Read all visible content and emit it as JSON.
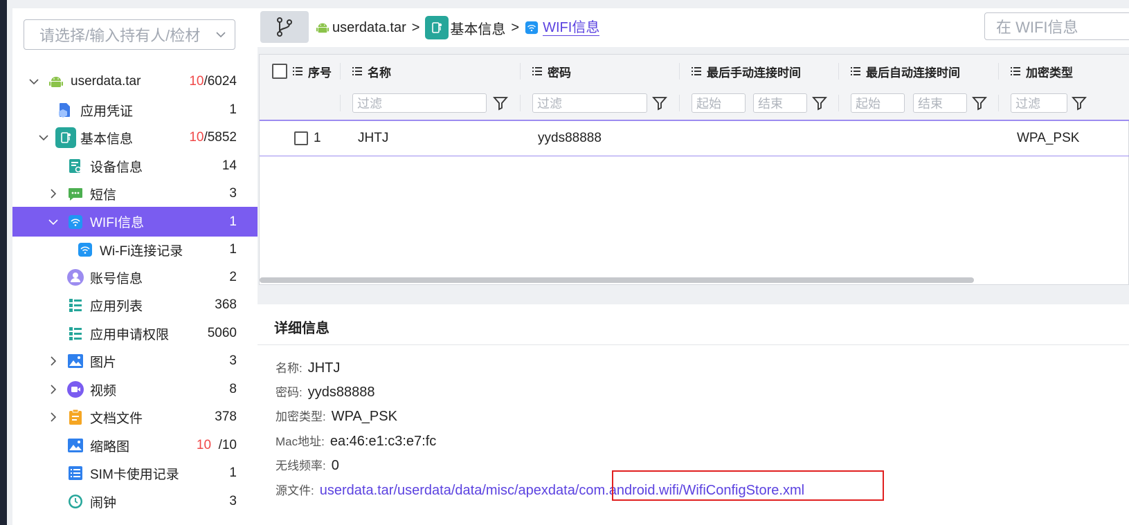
{
  "sidebar": {
    "select_placeholder": "请选择/输入持有人/检材",
    "tree": [
      {
        "label": "userdata.tar",
        "count_red": "10",
        "count_total": "/6024",
        "expanded": true,
        "icon": "android-icon"
      },
      {
        "label": "应用凭证",
        "count": "1",
        "icon": "credential-icon"
      },
      {
        "label": "基本信息",
        "count_red": "10",
        "count_total": "/5852",
        "expanded": true,
        "icon": "basic-info-icon"
      },
      {
        "label": "设备信息",
        "count": "14",
        "icon": "device-info-icon"
      },
      {
        "label": "短信",
        "count": "3",
        "icon": "sms-icon"
      },
      {
        "label": "WIFI信息",
        "count": "1",
        "selected": true,
        "expanded": true,
        "icon": "wifi-icon"
      },
      {
        "label": "Wi-Fi连接记录",
        "count": "1",
        "icon": "wifi-icon"
      },
      {
        "label": "账号信息",
        "count": "2",
        "icon": "account-icon"
      },
      {
        "label": "应用列表",
        "count": "368",
        "icon": "app-list-icon"
      },
      {
        "label": "应用申请权限",
        "count": "5060",
        "icon": "app-list-icon"
      },
      {
        "label": "图片",
        "count": "3",
        "icon": "image-icon"
      },
      {
        "label": "视频",
        "count": "8",
        "icon": "video-icon"
      },
      {
        "label": "文档文件",
        "count": "378",
        "icon": "document-icon"
      },
      {
        "label": "缩略图",
        "count_red": "10",
        "count_total": "/10",
        "icon": "image-icon"
      },
      {
        "label": "SIM卡使用记录",
        "count": "1",
        "icon": "sim-list-icon"
      },
      {
        "label": "闹钟",
        "count": "3",
        "icon": "clock-icon"
      }
    ]
  },
  "breadcrumb": {
    "items": [
      "userdata.tar",
      "基本信息",
      "WIFI信息"
    ],
    "separator": ">"
  },
  "search": {
    "placeholder": "在 WIFI信息"
  },
  "table": {
    "columns": [
      "序号",
      "名称",
      "密码",
      "最后手动连接时间",
      "最后自动连接时间",
      "加密类型"
    ],
    "filter_placeholder": "过滤",
    "range_start": "起始",
    "range_end": "结束",
    "rows": [
      {
        "index": "1",
        "name": "JHTJ",
        "password": "yyds88888",
        "manual_time": "",
        "auto_time": "",
        "encryption": "WPA_PSK"
      }
    ]
  },
  "detail": {
    "title": "详细信息",
    "fields": [
      {
        "label": "名称:",
        "value": "JHTJ"
      },
      {
        "label": "密码:",
        "value": "yyds88888"
      },
      {
        "label": "加密类型:",
        "value": "WPA_PSK"
      },
      {
        "label": "Mac地址:",
        "value": "ea:46:e1:c3:e7:fc"
      },
      {
        "label": "无线频率:",
        "value": "0"
      }
    ],
    "source_label": "源文件:",
    "source_path": "userdata.tar/userdata/data/misc/apexdata/com.android.wifi/WifiConfigStore.xml"
  },
  "colors": {
    "accent": "#7a5cf0",
    "link": "#5b42e0",
    "red_count": "#f04848",
    "highlight_box": "#e02020"
  }
}
